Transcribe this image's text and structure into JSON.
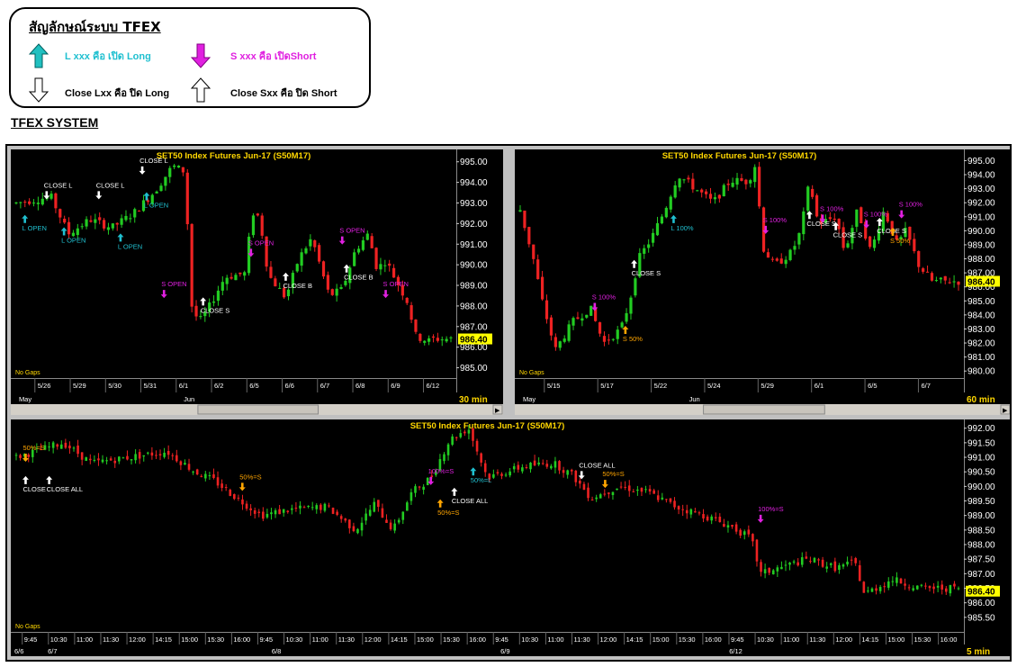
{
  "legend": {
    "title": "สัญลักษณ์ระบบ TFEX",
    "items": [
      {
        "label": "L xxx คือ เปิด Long",
        "color": "#20c0d0",
        "icon": "arrow-up-filled"
      },
      {
        "label": "S xxx คือ เปิดShort",
        "color": "#e020e0",
        "icon": "arrow-down-filled"
      },
      {
        "label": "Close Lxx คือ ปิด Long",
        "color": "#000000",
        "icon": "arrow-down-outline"
      },
      {
        "label": "Close Sxx คือ ปิด Short",
        "color": "#000000",
        "icon": "arrow-up-outline"
      }
    ]
  },
  "section_title": "TFEX SYSTEM",
  "colors": {
    "bg": "#000000",
    "up": "#22cc22",
    "down": "#ee2222",
    "title": "#ffd700",
    "last_price_bg": "#ffff00"
  },
  "chart_data": [
    {
      "type": "candlestick",
      "title": "SET50  Index  Futures  Jun-17   (S50M17)",
      "timeframe": "30  min",
      "no_gaps_label": "No Gaps",
      "ylim": [
        984.5,
        995.6
      ],
      "y_ticks": [
        "995.00",
        "994.00",
        "993.00",
        "992.00",
        "991.00",
        "990.00",
        "989.00",
        "988.00",
        "987.00",
        "986.00",
        "985.00"
      ],
      "last_price": "986.40",
      "date_labels": [
        "5/26",
        "5/29",
        "5/30",
        "5/31",
        "6/1",
        "6/2",
        "6/5",
        "6/6",
        "6/7",
        "6/8",
        "6/9",
        "6/12"
      ],
      "month_labels": [
        "May",
        "Jun"
      ],
      "path": [
        [
          0,
          993
        ],
        [
          8,
          993.3
        ],
        [
          12,
          991.5
        ],
        [
          17,
          992.2
        ],
        [
          22,
          991.8
        ],
        [
          27,
          992.5
        ],
        [
          32,
          993.6
        ],
        [
          36,
          994.8
        ],
        [
          39,
          994.5
        ],
        [
          40,
          988.2
        ],
        [
          42,
          987.2
        ],
        [
          44,
          987.8
        ],
        [
          48,
          989.4
        ],
        [
          53,
          989.6
        ],
        [
          54,
          992.6
        ],
        [
          56,
          992.3
        ],
        [
          58,
          989.5
        ],
        [
          62,
          988.4
        ],
        [
          65,
          990.3
        ],
        [
          68,
          991.3
        ],
        [
          72,
          988.5
        ],
        [
          75,
          988.8
        ],
        [
          78,
          990.7
        ],
        [
          81,
          991.5
        ],
        [
          83,
          989.8
        ],
        [
          85,
          990.2
        ],
        [
          88,
          989
        ],
        [
          90,
          988.2
        ],
        [
          92,
          986.5
        ],
        [
          95,
          986.3
        ],
        [
          96,
          986.4
        ]
      ],
      "markers": [
        {
          "x": 2,
          "y": 992.2,
          "dir": "up",
          "color": "#20c0d0",
          "label": "L  OPEN"
        },
        {
          "x": 7,
          "y": 993.4,
          "dir": "down",
          "color": "#ffffff",
          "label": "CLOSE  L"
        },
        {
          "x": 11,
          "y": 991.6,
          "dir": "up",
          "color": "#20c0d0",
          "label": "L  OPEN"
        },
        {
          "x": 19,
          "y": 993.4,
          "dir": "down",
          "color": "#ffffff",
          "label": "CLOSE  L"
        },
        {
          "x": 24,
          "y": 991.3,
          "dir": "up",
          "color": "#20c0d0",
          "label": "L  OPEN"
        },
        {
          "x": 29,
          "y": 994.6,
          "dir": "down",
          "color": "#ffffff",
          "label": "CLOSE  L"
        },
        {
          "x": 30,
          "y": 993.3,
          "dir": "up",
          "color": "#20c0d0",
          "label": "L  OPEN"
        },
        {
          "x": 34,
          "y": 988.6,
          "dir": "down",
          "color": "#e020e0",
          "label": "S  OPEN"
        },
        {
          "x": 43,
          "y": 988.2,
          "dir": "up",
          "color": "#ffffff",
          "label": "CLOSE  S"
        },
        {
          "x": 54,
          "y": 990.6,
          "dir": "down",
          "color": "#e020e0",
          "label": "S  OPEN"
        },
        {
          "x": 62,
          "y": 989.4,
          "dir": "up",
          "color": "#ffffff",
          "label": "CLOSE  B"
        },
        {
          "x": 75,
          "y": 991.2,
          "dir": "down",
          "color": "#e020e0",
          "label": "S  OPEN"
        },
        {
          "x": 76,
          "y": 989.8,
          "dir": "up",
          "color": "#ffffff",
          "label": "CLOSE  B"
        },
        {
          "x": 85,
          "y": 988.6,
          "dir": "down",
          "color": "#e020e0",
          "label": "S  OPEN"
        }
      ]
    },
    {
      "type": "candlestick",
      "title": "SET50  Index  Futures  Jun-17   (S50M17)",
      "timeframe": "60  min",
      "no_gaps_label": "No Gaps",
      "ylim": [
        979.5,
        995.8
      ],
      "y_ticks": [
        "995.00",
        "994.00",
        "993.00",
        "992.00",
        "991.00",
        "990.00",
        "989.00",
        "988.00",
        "987.00",
        "986.00",
        "985.00",
        "984.00",
        "983.00",
        "982.00",
        "981.00",
        "980.00"
      ],
      "last_price": "986.40",
      "date_labels": [
        "5/15",
        "5/17",
        "5/22",
        "5/24",
        "5/29",
        "6/1",
        "6/5",
        "6/7"
      ],
      "month_labels": [
        "May",
        "Jun"
      ],
      "path": [
        [
          0,
          991.5
        ],
        [
          3,
          988
        ],
        [
          5,
          985
        ],
        [
          8,
          981.5
        ],
        [
          12,
          983.5
        ],
        [
          16,
          984.5
        ],
        [
          19,
          982
        ],
        [
          23,
          983
        ],
        [
          25,
          985
        ],
        [
          27,
          988
        ],
        [
          30,
          989.5
        ],
        [
          33,
          991.5
        ],
        [
          36,
          994
        ],
        [
          40,
          993
        ],
        [
          44,
          992
        ],
        [
          48,
          993.6
        ],
        [
          52,
          993.5
        ],
        [
          54,
          995
        ],
        [
          55,
          989
        ],
        [
          58,
          987.5
        ],
        [
          62,
          988.5
        ],
        [
          64,
          990
        ],
        [
          66,
          993.5
        ],
        [
          68,
          990.5
        ],
        [
          72,
          991
        ],
        [
          74,
          988.5
        ],
        [
          77,
          991.5
        ],
        [
          80,
          988.5
        ],
        [
          83,
          991.5
        ],
        [
          86,
          989
        ],
        [
          88,
          990
        ],
        [
          91,
          987.5
        ],
        [
          94,
          986.4
        ]
      ],
      "markers": [
        {
          "x": 17,
          "y": 984.6,
          "dir": "down",
          "color": "#e020e0",
          "label": "S  100%"
        },
        {
          "x": 24,
          "y": 982.9,
          "dir": "up",
          "color": "#ffa500",
          "label": "S  50%"
        },
        {
          "x": 26,
          "y": 987.6,
          "dir": "up",
          "color": "#ffffff",
          "label": "CLOSE  S"
        },
        {
          "x": 35,
          "y": 990.8,
          "dir": "up",
          "color": "#20c0d0",
          "label": "L  100%"
        },
        {
          "x": 56,
          "y": 990.1,
          "dir": "down",
          "color": "#e020e0",
          "label": "S  100%"
        },
        {
          "x": 66,
          "y": 991.1,
          "dir": "up",
          "color": "#ffffff",
          "label": "CLOSE  S"
        },
        {
          "x": 69,
          "y": 990.9,
          "dir": "down",
          "color": "#e020e0",
          "label": "S  100%"
        },
        {
          "x": 72,
          "y": 990.3,
          "dir": "up",
          "color": "#ffffff",
          "label": "CLOSE  S"
        },
        {
          "x": 79,
          "y": 990.5,
          "dir": "down",
          "color": "#e020e0",
          "label": "S  100%"
        },
        {
          "x": 82,
          "y": 990.6,
          "dir": "up",
          "color": "#ffffff",
          "label": "CLOSE  S"
        },
        {
          "x": 85,
          "y": 989.9,
          "dir": "up",
          "color": "#ffa500",
          "label": "S  50%"
        },
        {
          "x": 87,
          "y": 991.2,
          "dir": "down",
          "color": "#e020e0",
          "label": "S  100%"
        }
      ]
    },
    {
      "type": "candlestick",
      "title": "SET50  Index  Futures  Jun-17   (S50M17)",
      "timeframe": "5  min",
      "no_gaps_label": "No Gaps",
      "ylim": [
        985,
        992.3
      ],
      "y_ticks": [
        "992.00",
        "991.50",
        "991.00",
        "990.50",
        "990.00",
        "989.50",
        "989.00",
        "988.50",
        "988.00",
        "987.50",
        "987.00",
        "986.50",
        "986.00",
        "985.50"
      ],
      "last_price": "986.40",
      "time_labels": [
        "9:45",
        "10:30",
        "11:00",
        "11:30",
        "12:00",
        "14:15",
        "15:00",
        "15:30",
        "16:00",
        "9:45",
        "10:30",
        "11:00",
        "11:30",
        "12:00",
        "14:15",
        "15:00",
        "15:30",
        "16:00",
        "9:45",
        "10:30",
        "11:00",
        "11:30",
        "12:00",
        "14:15",
        "15:00",
        "15:30",
        "16:00",
        "9:45",
        "10:30",
        "11:00",
        "11:30",
        "12:00",
        "14:15",
        "15:00",
        "15:30",
        "16:00"
      ],
      "date_labels": [
        "6/6",
        "6/7",
        "6/8",
        "6/9",
        "6/12"
      ],
      "path": [
        [
          0,
          991
        ],
        [
          3,
          991.3
        ],
        [
          5,
          991.5
        ],
        [
          8,
          990.8
        ],
        [
          12,
          991
        ],
        [
          16,
          991.2
        ],
        [
          19,
          990.5
        ],
        [
          21,
          990.2
        ],
        [
          23,
          989.7
        ],
        [
          26,
          989
        ],
        [
          29,
          989.2
        ],
        [
          33,
          989.3
        ],
        [
          36,
          988.5
        ],
        [
          38,
          989.4
        ],
        [
          40,
          988.5
        ],
        [
          42,
          989.8
        ],
        [
          44,
          990.3
        ],
        [
          46,
          991.6
        ],
        [
          48,
          992
        ],
        [
          50,
          990.3
        ],
        [
          54,
          990.7
        ],
        [
          57,
          990.8
        ],
        [
          59,
          990.4
        ],
        [
          61,
          989.6
        ],
        [
          64,
          990
        ],
        [
          67,
          989.8
        ],
        [
          70,
          989.3
        ],
        [
          73,
          989
        ],
        [
          76,
          988.6
        ],
        [
          78,
          988.2
        ],
        [
          79,
          987
        ],
        [
          82,
          987.3
        ],
        [
          84,
          987.5
        ],
        [
          87,
          987.2
        ],
        [
          89,
          987.4
        ],
        [
          90,
          986.3
        ],
        [
          93,
          986.8
        ],
        [
          96,
          986.5
        ]
      ],
      "markers": [
        {
          "x": 1,
          "y": 991,
          "dir": "down",
          "color": "#ffa500",
          "label": "50%=S"
        },
        {
          "x": 1,
          "y": 990.2,
          "dir": "up",
          "color": "#ffffff",
          "label": "CLOSE"
        },
        {
          "x": 3.5,
          "y": 990.2,
          "dir": "up",
          "color": "#ffffff",
          "label": "CLOSE  ALL"
        },
        {
          "x": 24,
          "y": 990,
          "dir": "down",
          "color": "#ffa500",
          "label": "50%=S"
        },
        {
          "x": 44,
          "y": 990.2,
          "dir": "down",
          "color": "#e020e0",
          "label": "100%=S"
        },
        {
          "x": 45,
          "y": 989.4,
          "dir": "up",
          "color": "#ffa500",
          "label": "50%=S"
        },
        {
          "x": 46.5,
          "y": 989.8,
          "dir": "up",
          "color": "#ffffff",
          "label": "CLOSE  ALL"
        },
        {
          "x": 48.5,
          "y": 990.5,
          "dir": "up",
          "color": "#20c0d0",
          "label": "50%=L"
        },
        {
          "x": 60,
          "y": 990.4,
          "dir": "down",
          "color": "#ffffff",
          "label": "CLOSE  ALL"
        },
        {
          "x": 62.5,
          "y": 990.1,
          "dir": "down",
          "color": "#ffa500",
          "label": "50%=S"
        },
        {
          "x": 79,
          "y": 988.9,
          "dir": "down",
          "color": "#e020e0",
          "label": "100%=S"
        }
      ]
    }
  ]
}
